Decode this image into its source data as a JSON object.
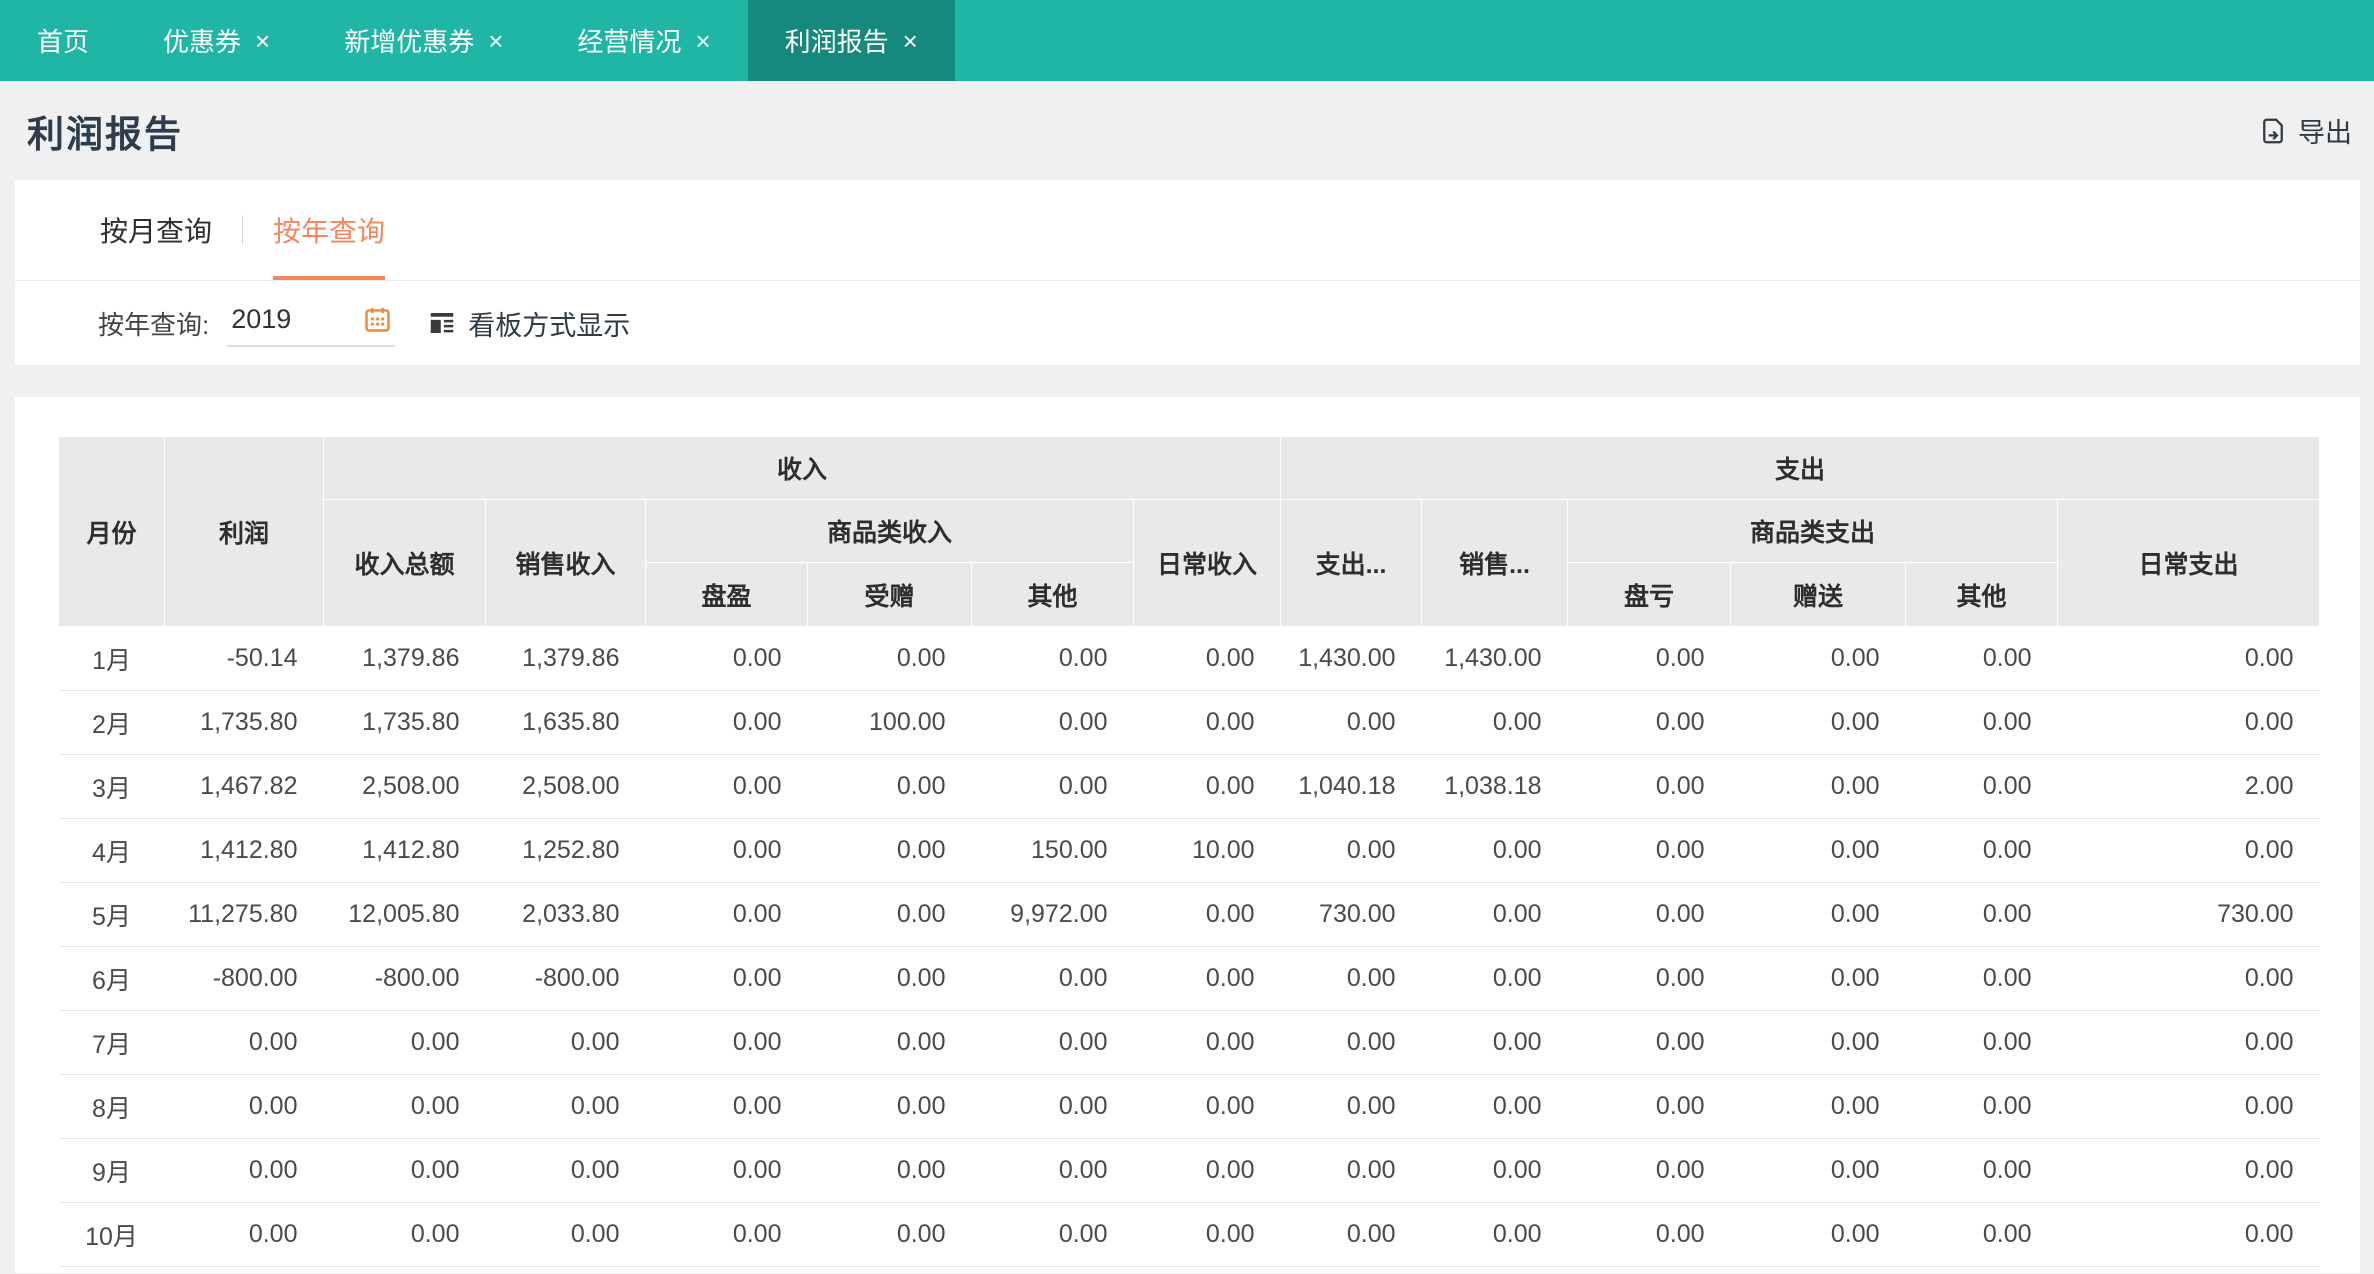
{
  "tab_bar": {
    "tabs": [
      {
        "label": "首页"
      },
      {
        "label": "优惠券"
      },
      {
        "label": "新增优惠券"
      },
      {
        "label": "经营情况"
      },
      {
        "label": "利润报告"
      }
    ]
  },
  "header": {
    "title": "利润报告",
    "export_label": "导出"
  },
  "query_tabs": {
    "month_label": "按月查询",
    "year_label": "按年查询"
  },
  "filter": {
    "year_label": "按年查询:",
    "year_value": "2019",
    "board_label": "看板方式显示"
  },
  "colors": {
    "accent_teal": "#20b6a5",
    "active_tab_teal": "#15897b",
    "accent_orange": "#f6875f"
  },
  "table": {
    "header": {
      "month": "月份",
      "profit": "利润",
      "income_group": "收入",
      "expense_group": "支出",
      "income_total": "收入总额",
      "sales_income": "销售收入",
      "product_income_group": "商品类收入",
      "inventory_gain": "盘盈",
      "gift_received": "受赠",
      "other_income": "其他",
      "daily_income": "日常收入",
      "expense_total": "支出...",
      "sales_expense": "销售...",
      "product_expense_group": "商品类支出",
      "inventory_loss": "盘亏",
      "gift_given": "赠送",
      "other_expense": "其他",
      "daily_expense": "日常支出"
    },
    "rows": [
      {
        "month": "1月",
        "values": [
          "-50.14",
          "1,379.86",
          "1,379.86",
          "0.00",
          "0.00",
          "0.00",
          "0.00",
          "1,430.00",
          "1,430.00",
          "0.00",
          "0.00",
          "0.00",
          "0.00"
        ]
      },
      {
        "month": "2月",
        "values": [
          "1,735.80",
          "1,735.80",
          "1,635.80",
          "0.00",
          "100.00",
          "0.00",
          "0.00",
          "0.00",
          "0.00",
          "0.00",
          "0.00",
          "0.00",
          "0.00"
        ]
      },
      {
        "month": "3月",
        "values": [
          "1,467.82",
          "2,508.00",
          "2,508.00",
          "0.00",
          "0.00",
          "0.00",
          "0.00",
          "1,040.18",
          "1,038.18",
          "0.00",
          "0.00",
          "0.00",
          "2.00"
        ]
      },
      {
        "month": "4月",
        "values": [
          "1,412.80",
          "1,412.80",
          "1,252.80",
          "0.00",
          "0.00",
          "150.00",
          "10.00",
          "0.00",
          "0.00",
          "0.00",
          "0.00",
          "0.00",
          "0.00"
        ]
      },
      {
        "month": "5月",
        "values": [
          "11,275.80",
          "12,005.80",
          "2,033.80",
          "0.00",
          "0.00",
          "9,972.00",
          "0.00",
          "730.00",
          "0.00",
          "0.00",
          "0.00",
          "0.00",
          "730.00"
        ]
      },
      {
        "month": "6月",
        "values": [
          "-800.00",
          "-800.00",
          "-800.00",
          "0.00",
          "0.00",
          "0.00",
          "0.00",
          "0.00",
          "0.00",
          "0.00",
          "0.00",
          "0.00",
          "0.00"
        ]
      },
      {
        "month": "7月",
        "values": [
          "0.00",
          "0.00",
          "0.00",
          "0.00",
          "0.00",
          "0.00",
          "0.00",
          "0.00",
          "0.00",
          "0.00",
          "0.00",
          "0.00",
          "0.00"
        ]
      },
      {
        "month": "8月",
        "values": [
          "0.00",
          "0.00",
          "0.00",
          "0.00",
          "0.00",
          "0.00",
          "0.00",
          "0.00",
          "0.00",
          "0.00",
          "0.00",
          "0.00",
          "0.00"
        ]
      },
      {
        "month": "9月",
        "values": [
          "0.00",
          "0.00",
          "0.00",
          "0.00",
          "0.00",
          "0.00",
          "0.00",
          "0.00",
          "0.00",
          "0.00",
          "0.00",
          "0.00",
          "0.00"
        ]
      },
      {
        "month": "10月",
        "values": [
          "0.00",
          "0.00",
          "0.00",
          "0.00",
          "0.00",
          "0.00",
          "0.00",
          "0.00",
          "0.00",
          "0.00",
          "0.00",
          "0.00",
          "0.00"
        ]
      }
    ]
  }
}
